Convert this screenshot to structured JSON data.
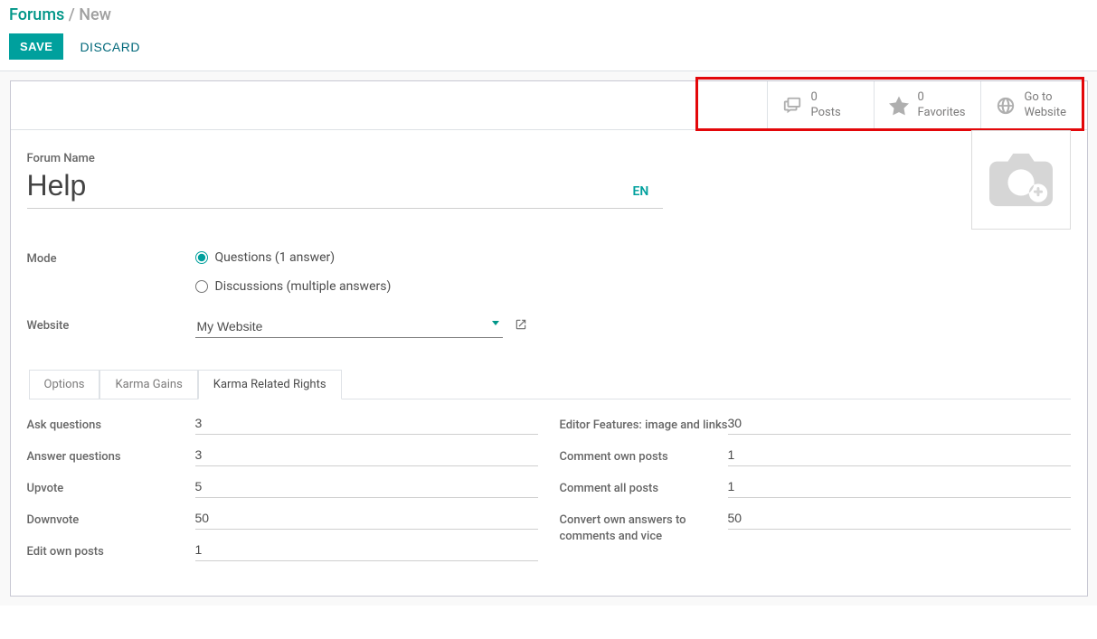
{
  "breadcrumb": {
    "root": "Forums",
    "current": "New"
  },
  "actions": {
    "save": "SAVE",
    "discard": "DISCARD"
  },
  "stat_buttons": {
    "posts": {
      "count": "0",
      "label": "Posts"
    },
    "favorites": {
      "count": "0",
      "label": "Favorites"
    },
    "website": {
      "line1": "Go to",
      "line2": "Website"
    }
  },
  "form": {
    "name_label": "Forum Name",
    "name_value": "Help",
    "lang": "EN",
    "mode_label": "Mode",
    "mode_options": {
      "questions": "Questions (1 answer)",
      "discussions": "Discussions (multiple answers)"
    },
    "website_label": "Website",
    "website_value": "My Website"
  },
  "tabs": {
    "options": "Options",
    "karma_gains": "Karma Gains",
    "karma_rights": "Karma Related Rights"
  },
  "rights": {
    "left": [
      {
        "label": "Ask questions",
        "value": "3"
      },
      {
        "label": "Answer questions",
        "value": "3"
      },
      {
        "label": "Upvote",
        "value": "5"
      },
      {
        "label": "Downvote",
        "value": "50"
      },
      {
        "label": "Edit own posts",
        "value": "1"
      }
    ],
    "right": [
      {
        "label": "Editor Features: image and links",
        "value": "30"
      },
      {
        "label": "Comment own posts",
        "value": "1"
      },
      {
        "label": "Comment all posts",
        "value": "1"
      },
      {
        "label": "Convert own answers to comments and vice",
        "value": "50"
      }
    ]
  }
}
